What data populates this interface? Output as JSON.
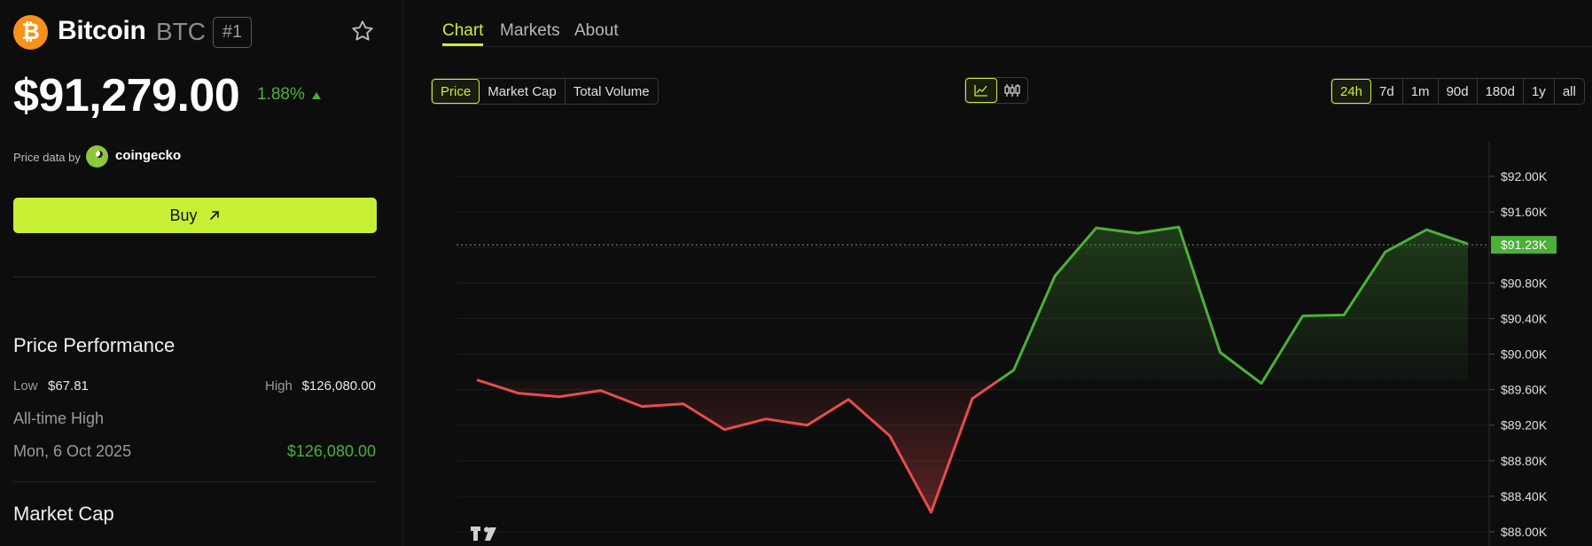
{
  "coin": {
    "logo_glyph": "₿",
    "name": "Bitcoin",
    "symbol": "BTC",
    "rank": "#1",
    "price": "$91,279.00",
    "change_pct": "1.88%",
    "change_color": "#4caf3a"
  },
  "source": {
    "label": "Price data by",
    "name": "coingecko"
  },
  "buy": {
    "label": "Buy"
  },
  "performance": {
    "title": "Price Performance",
    "low_label": "Low",
    "low_value": "$67.81",
    "high_label": "High",
    "high_value": "$126,080.00",
    "ath_label": "All-time High",
    "ath_date": "Mon, 6 Oct 2025",
    "ath_value": "$126,080.00"
  },
  "market_cap": {
    "title": "Market Cap"
  },
  "tabs": [
    {
      "label": "Chart",
      "active": true
    },
    {
      "label": "Markets",
      "active": false
    },
    {
      "label": "About",
      "active": false
    }
  ],
  "metric_toggle": [
    "Price",
    "Market Cap",
    "Total Volume"
  ],
  "metric_active": "Price",
  "chart_style_icons": [
    "line-chart-icon",
    "candlestick-icon"
  ],
  "ranges": [
    "24h",
    "7d",
    "1m",
    "90d",
    "180d",
    "1y",
    "all"
  ],
  "range_active": "24h",
  "colors": {
    "accent": "#c7f034",
    "up": "#4caf3a",
    "down": "#e74c4c",
    "background": "#0d0d0d"
  },
  "chart_data": {
    "type": "area",
    "title": "",
    "xlabel": "",
    "ylabel": "",
    "ylim": [
      88000,
      92200
    ],
    "y_ticks": [
      92000,
      91600,
      90800,
      90400,
      90000,
      89600,
      89200,
      88800,
      88400,
      88000
    ],
    "y_tick_labels": [
      "$92.00K",
      "$91.60K",
      "$90.80K",
      "$90.40K",
      "$90.00K",
      "$89.60K",
      "$89.20K",
      "$88.80K",
      "$88.40K",
      "$88.00K"
    ],
    "baseline": 89700,
    "current_value": 91230,
    "current_label": "$91.23K",
    "grid": true,
    "values": [
      89710,
      89560,
      89520,
      89590,
      89410,
      89440,
      89150,
      89270,
      89200,
      89490,
      89080,
      88220,
      89500,
      89820,
      90880,
      91420,
      91360,
      91430,
      90020,
      89670,
      90430,
      90440,
      91150,
      91400,
      91240
    ]
  }
}
